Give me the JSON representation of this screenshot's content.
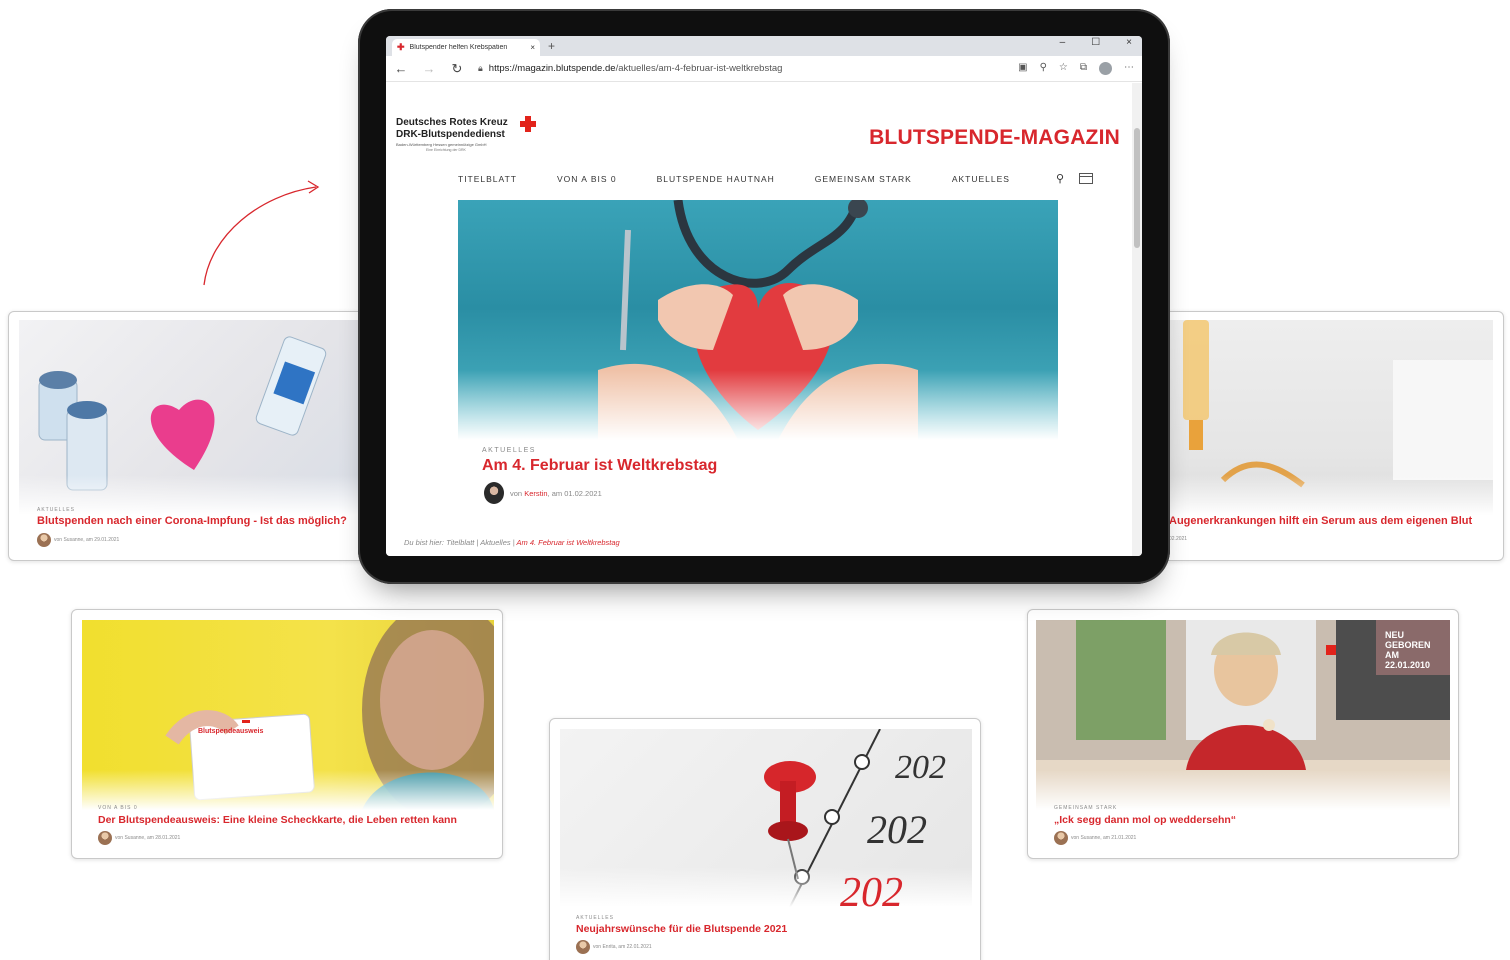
{
  "browser": {
    "tab_title": "Blutspender helfen Krebspatien",
    "tab_close": "×",
    "new_tab": "+",
    "window_controls": [
      "–",
      "☐",
      "×"
    ],
    "url_host": "https://magazin.blutspende.de",
    "url_path": "/aktuelles/am-4-februar-ist-weltkrebstag"
  },
  "site": {
    "logo_line1": "Deutsches Rotes Kreuz",
    "logo_line2": "DRK-Blutspendedienst",
    "logo_line3": "Baden-Württemberg Hessen gemeinnützige GmbH",
    "logo_line4": "Eine Einrichtung der DRK",
    "magazine_title": "BLUTSPENDE-MAGAZIN",
    "nav": [
      "TITELBLATT",
      "VON A BIS 0",
      "BLUTSPENDE HAUTNAH",
      "GEMEINSAM STARK",
      "AKTUELLES"
    ]
  },
  "featured": {
    "category": "AKTUELLES",
    "title": "Am 4. Februar ist Weltkrebstag",
    "meta_prefix": "von",
    "author": "Kerstin",
    "date": ", am 01.02.2021",
    "breadcrumb_prefix": "Du bist hier: Titelblatt | Aktuelles |",
    "breadcrumb_current": "Am 4. Februar ist Weltkrebstag"
  },
  "cards": {
    "corona": {
      "category": "AKTUELLES",
      "title": "Blutspenden nach einer Corona-Impfung - Ist das möglich?",
      "meta": "von Susanne, am 29.01.2021"
    },
    "serum": {
      "title": "Augenerkrankungen hilft ein Serum aus dem eigenen Blut",
      "meta": "02.2021"
    },
    "ausweis": {
      "category": "VON A BIS 0",
      "title": "Der Blutspendeausweis: Eine kleine Scheckkarte, die Leben retten kann",
      "meta": "von Susanne, am 28.01.2021",
      "card_label": "Blutspendeausweis"
    },
    "neujahr": {
      "category": "AKTUELLES",
      "title": "Neujahrswünsche für die Blutspende 2021",
      "meta": "von Enrita, am 22.01.2021",
      "years": [
        "202",
        "202",
        "202"
      ]
    },
    "weddersehn": {
      "category": "GEMEINSAM STARK",
      "title": "„Ick segg dann mol op weddersehn“",
      "meta": "von Susanne, am 21.01.2021",
      "poster": "NEU GEBOREN AM 22.01.2010"
    }
  },
  "colors": {
    "accent": "#d8272d",
    "drk_red": "#e2231a",
    "muted": "#888888"
  }
}
